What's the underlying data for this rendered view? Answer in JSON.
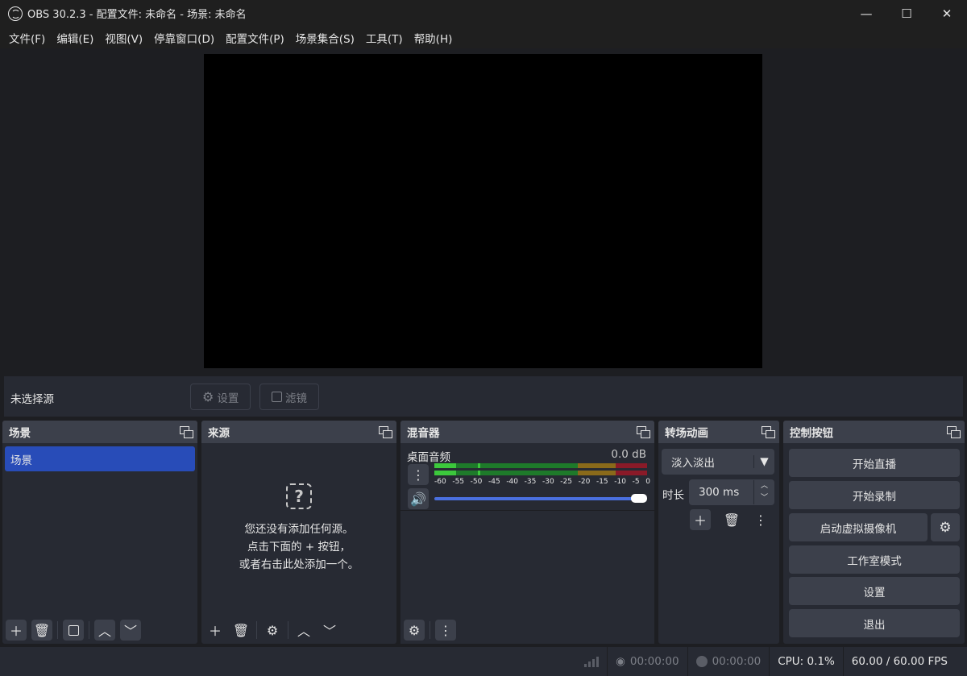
{
  "window": {
    "title": "OBS 30.2.3 - 配置文件: 未命名 - 场景: 未命名",
    "minimize": "—",
    "maximize": "☐",
    "close": "✕"
  },
  "menu": [
    "文件(F)",
    "编辑(E)",
    "视图(V)",
    "停靠窗口(D)",
    "配置文件(P)",
    "场景集合(S)",
    "工具(T)",
    "帮助(H)"
  ],
  "context_bar": {
    "no_source": "未选择源",
    "properties": "设置",
    "filters": "滤镜"
  },
  "docks": {
    "scenes": {
      "title": "场景",
      "items": [
        "场景"
      ]
    },
    "sources": {
      "title": "来源",
      "empty_lines": [
        "您还没有添加任何源。",
        "点击下面的 + 按钮，",
        "或者右击此处添加一个。"
      ]
    },
    "mixer": {
      "title": "混音器",
      "channel": {
        "name": "桌面音频",
        "level": "0.0 dB"
      },
      "ticks": [
        "-60",
        "-55",
        "-50",
        "-45",
        "-40",
        "-35",
        "-30",
        "-25",
        "-20",
        "-15",
        "-10",
        "-5",
        "0"
      ],
      "volume_fraction": 1.0
    },
    "transitions": {
      "title": "转场动画",
      "selected": "淡入淡出",
      "duration_label": "时长",
      "duration_value": "300 ms"
    },
    "controls": {
      "title": "控制按钮",
      "start_stream": "开始直播",
      "start_record": "开始录制",
      "virtual_cam": "启动虚拟摄像机",
      "studio_mode": "工作室模式",
      "settings": "设置",
      "exit": "退出"
    }
  },
  "status": {
    "stream_time": "00:00:00",
    "record_time": "00:00:00",
    "cpu": "CPU: 0.1%",
    "fps": "60.00 / 60.00 FPS"
  },
  "colors": {
    "accent": "#284cb8",
    "meter_green": "#3cc83c",
    "meter_yellow": "#c8a028",
    "meter_red": "#c82828",
    "slider": "#4a70e0"
  }
}
